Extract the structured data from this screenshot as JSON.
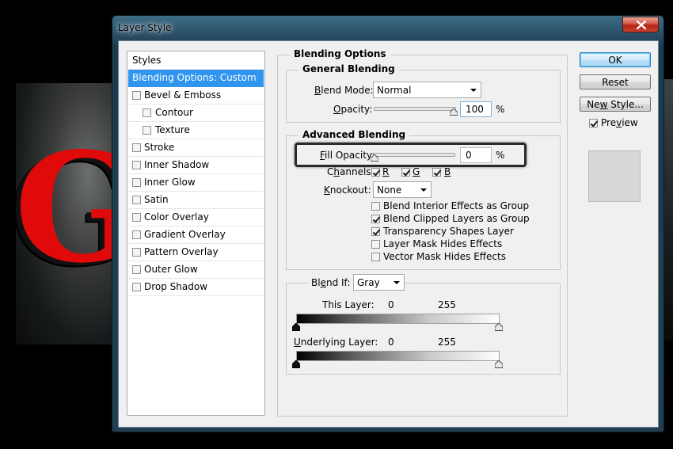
{
  "window": {
    "title": "Layer Style"
  },
  "styles_list": {
    "header": "Styles",
    "items": [
      {
        "label": "Blending Options: Custom",
        "checkbox": false,
        "checked": false,
        "selected": true
      },
      {
        "label": "Bevel & Emboss",
        "checkbox": true,
        "checked": false
      },
      {
        "label": "Contour",
        "checkbox": true,
        "checked": false,
        "indent": true
      },
      {
        "label": "Texture",
        "checkbox": true,
        "checked": false,
        "indent": true
      },
      {
        "label": "Stroke",
        "checkbox": true,
        "checked": false
      },
      {
        "label": "Inner Shadow",
        "checkbox": true,
        "checked": false
      },
      {
        "label": "Inner Glow",
        "checkbox": true,
        "checked": false
      },
      {
        "label": "Satin",
        "checkbox": true,
        "checked": false
      },
      {
        "label": "Color Overlay",
        "checkbox": true,
        "checked": false
      },
      {
        "label": "Gradient Overlay",
        "checkbox": true,
        "checked": false
      },
      {
        "label": "Pattern Overlay",
        "checkbox": true,
        "checked": false
      },
      {
        "label": "Outer Glow",
        "checkbox": true,
        "checked": false
      },
      {
        "label": "Drop Shadow",
        "checkbox": true,
        "checked": false
      }
    ]
  },
  "blending_options": {
    "title": "Blending Options",
    "general": {
      "title": "General Blending",
      "blend_mode_label": "Blend Mode:",
      "blend_mode_value": "Normal",
      "opacity_label": "Opacity:",
      "opacity_value": "100",
      "opacity_unit": "%",
      "opacity_level": 1.0
    },
    "advanced": {
      "title": "Advanced Blending",
      "fill_opacity_label": "Fill Opacity:",
      "fill_opacity_value": "0",
      "fill_opacity_unit": "%",
      "fill_opacity_level": 0.0,
      "channels_label": "Channels:",
      "channels": [
        {
          "label": "R",
          "checked": true
        },
        {
          "label": "G",
          "checked": true
        },
        {
          "label": "B",
          "checked": true
        }
      ],
      "knockout_label": "Knockout:",
      "knockout_value": "None",
      "options": [
        {
          "label": "Blend Interior Effects as Group",
          "checked": false
        },
        {
          "label": "Blend Clipped Layers as Group",
          "checked": true
        },
        {
          "label": "Transparency Shapes Layer",
          "checked": true
        },
        {
          "label": "Layer Mask Hides Effects",
          "checked": false
        },
        {
          "label": "Vector Mask Hides Effects",
          "checked": false
        }
      ]
    },
    "blend_if": {
      "label": "Blend If:",
      "value": "Gray",
      "this_layer_label": "This Layer:",
      "this_layer_min": "0",
      "this_layer_max": "255",
      "underlying_label": "Underlying Layer:",
      "underlying_min": "0",
      "underlying_max": "255"
    }
  },
  "buttons": {
    "ok": "OK",
    "reset": "Reset",
    "new_style": "New Style...",
    "preview_label": "Preview",
    "preview_checked": true
  },
  "background": {
    "letter": "G",
    "letter_color": "#e10a0a"
  },
  "colors": {
    "selection": "#2f95ee",
    "close_button": "#c9442f"
  }
}
